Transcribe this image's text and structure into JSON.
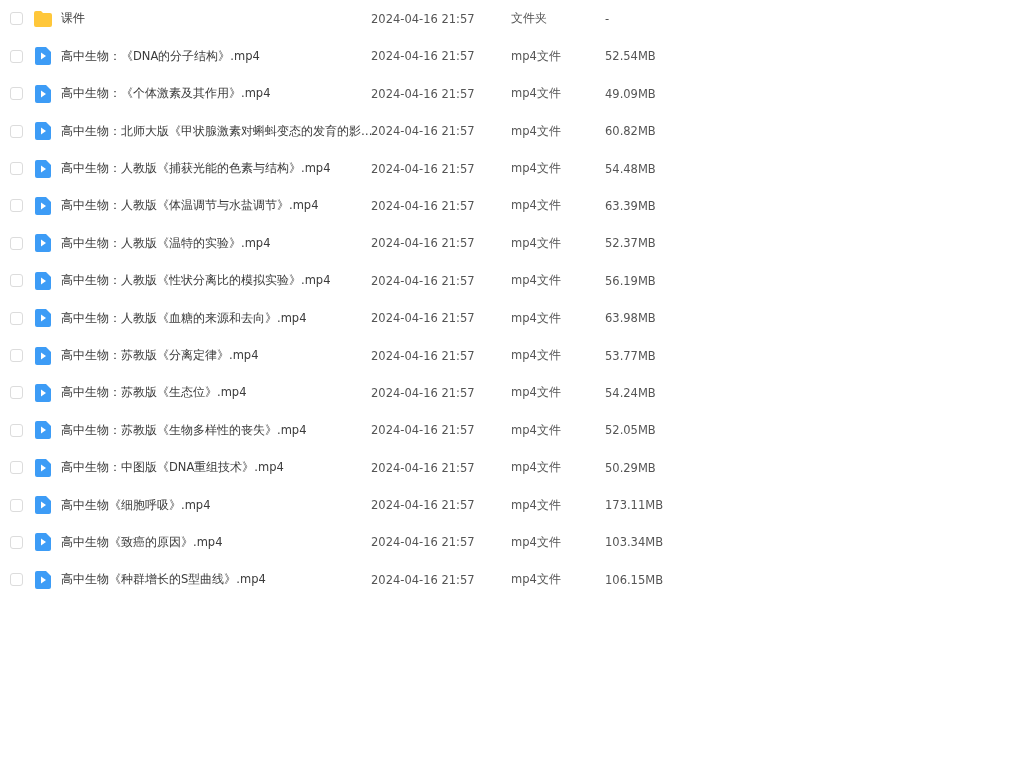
{
  "files": [
    {
      "kind": "folder",
      "checked": false,
      "name": "课件",
      "modified": "2024-04-16 21:57",
      "type": "文件夹",
      "size": "-"
    },
    {
      "kind": "video",
      "checked": false,
      "name": "高中生物：《DNA的分子结构》.mp4",
      "modified": "2024-04-16 21:57",
      "type": "mp4文件",
      "size": "52.54MB"
    },
    {
      "kind": "video",
      "checked": false,
      "name": "高中生物：《个体激素及其作用》.mp4",
      "modified": "2024-04-16 21:57",
      "type": "mp4文件",
      "size": "49.09MB"
    },
    {
      "kind": "video",
      "checked": false,
      "name": "高中生物：北师大版《甲状腺激素对蝌蚪变态的发育的影…",
      "modified": "2024-04-16 21:57",
      "type": "mp4文件",
      "size": "60.82MB"
    },
    {
      "kind": "video",
      "checked": false,
      "name": "高中生物：人教版《捕获光能的色素与结构》.mp4",
      "modified": "2024-04-16 21:57",
      "type": "mp4文件",
      "size": "54.48MB"
    },
    {
      "kind": "video",
      "checked": false,
      "name": "高中生物：人教版《体温调节与水盐调节》.mp4",
      "modified": "2024-04-16 21:57",
      "type": "mp4文件",
      "size": "63.39MB"
    },
    {
      "kind": "video",
      "checked": false,
      "name": "高中生物：人教版《温特的实验》.mp4",
      "modified": "2024-04-16 21:57",
      "type": "mp4文件",
      "size": "52.37MB"
    },
    {
      "kind": "video",
      "checked": false,
      "name": "高中生物：人教版《性状分离比的模拟实验》.mp4",
      "modified": "2024-04-16 21:57",
      "type": "mp4文件",
      "size": "56.19MB"
    },
    {
      "kind": "video",
      "checked": false,
      "name": "高中生物：人教版《血糖的来源和去向》.mp4",
      "modified": "2024-04-16 21:57",
      "type": "mp4文件",
      "size": "63.98MB"
    },
    {
      "kind": "video",
      "checked": false,
      "name": "高中生物：苏教版《分离定律》.mp4",
      "modified": "2024-04-16 21:57",
      "type": "mp4文件",
      "size": "53.77MB"
    },
    {
      "kind": "video",
      "checked": false,
      "name": "高中生物：苏教版《生态位》.mp4",
      "modified": "2024-04-16 21:57",
      "type": "mp4文件",
      "size": "54.24MB"
    },
    {
      "kind": "video",
      "checked": false,
      "name": "高中生物：苏教版《生物多样性的丧失》.mp4",
      "modified": "2024-04-16 21:57",
      "type": "mp4文件",
      "size": "52.05MB"
    },
    {
      "kind": "video",
      "checked": false,
      "name": "高中生物：中图版《DNA重组技术》.mp4",
      "modified": "2024-04-16 21:57",
      "type": "mp4文件",
      "size": "50.29MB"
    },
    {
      "kind": "video",
      "checked": false,
      "name": "高中生物《细胞呼吸》.mp4",
      "modified": "2024-04-16 21:57",
      "type": "mp4文件",
      "size": "173.11MB"
    },
    {
      "kind": "video",
      "checked": false,
      "name": "高中生物《致癌的原因》.mp4",
      "modified": "2024-04-16 21:57",
      "type": "mp4文件",
      "size": "103.34MB"
    },
    {
      "kind": "video",
      "checked": false,
      "name": "高中生物《种群增长的S型曲线》.mp4",
      "modified": "2024-04-16 21:57",
      "type": "mp4文件",
      "size": "106.15MB"
    }
  ]
}
